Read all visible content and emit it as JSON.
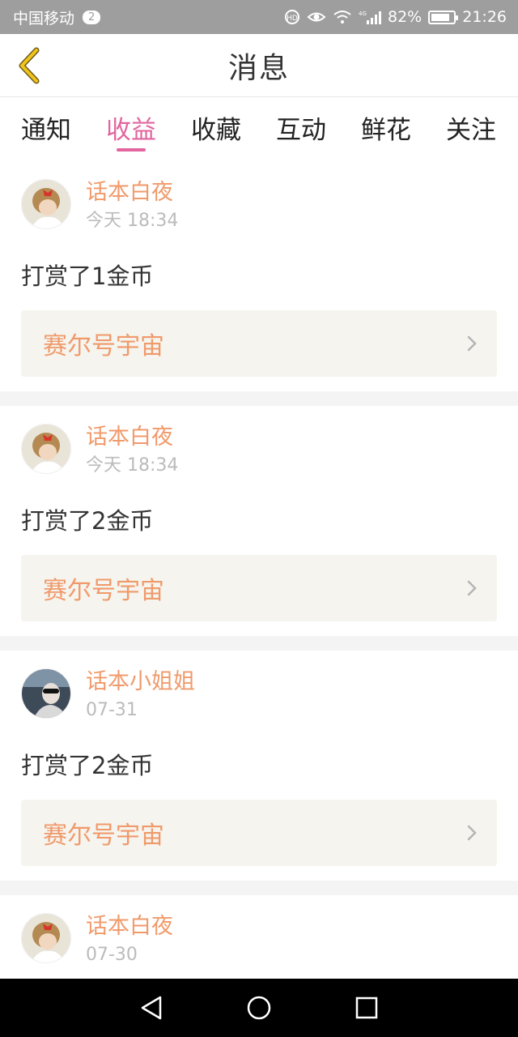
{
  "status_bar": {
    "carrier": "中国移动",
    "sim_badge": "2",
    "network": "4G",
    "battery": "82%",
    "battery_level": 0.82,
    "time": "21:26"
  },
  "header": {
    "title": "消息"
  },
  "tabs": [
    {
      "label": "通知",
      "active": false
    },
    {
      "label": "收益",
      "active": true
    },
    {
      "label": "收藏",
      "active": false
    },
    {
      "label": "互动",
      "active": false
    },
    {
      "label": "鲜花",
      "active": false
    },
    {
      "label": "关注",
      "active": false
    }
  ],
  "messages": [
    {
      "user": "话本白夜",
      "time": "今天 18:34",
      "text": "打赏了1金币",
      "link": "赛尔号宇宙"
    },
    {
      "user": "话本白夜",
      "time": "今天 18:34",
      "text": "打赏了2金币",
      "link": "赛尔号宇宙"
    },
    {
      "user": "话本小姐姐",
      "time": "07-31",
      "text": "打赏了2金币",
      "link": "赛尔号宇宙"
    },
    {
      "user": "话本白夜",
      "time": "07-30"
    }
  ],
  "colors": {
    "accent": "#e2659e",
    "name_orange": "#f09a6b",
    "back_arrow": "#f0c419",
    "link_bg": "#f5f4ee"
  },
  "icons": {
    "back": "chevron-left-icon",
    "link_arrow": "chevron-right-icon",
    "nav_back": "triangle-back-icon",
    "nav_home": "circle-home-icon",
    "nav_recent": "square-recents-icon"
  }
}
